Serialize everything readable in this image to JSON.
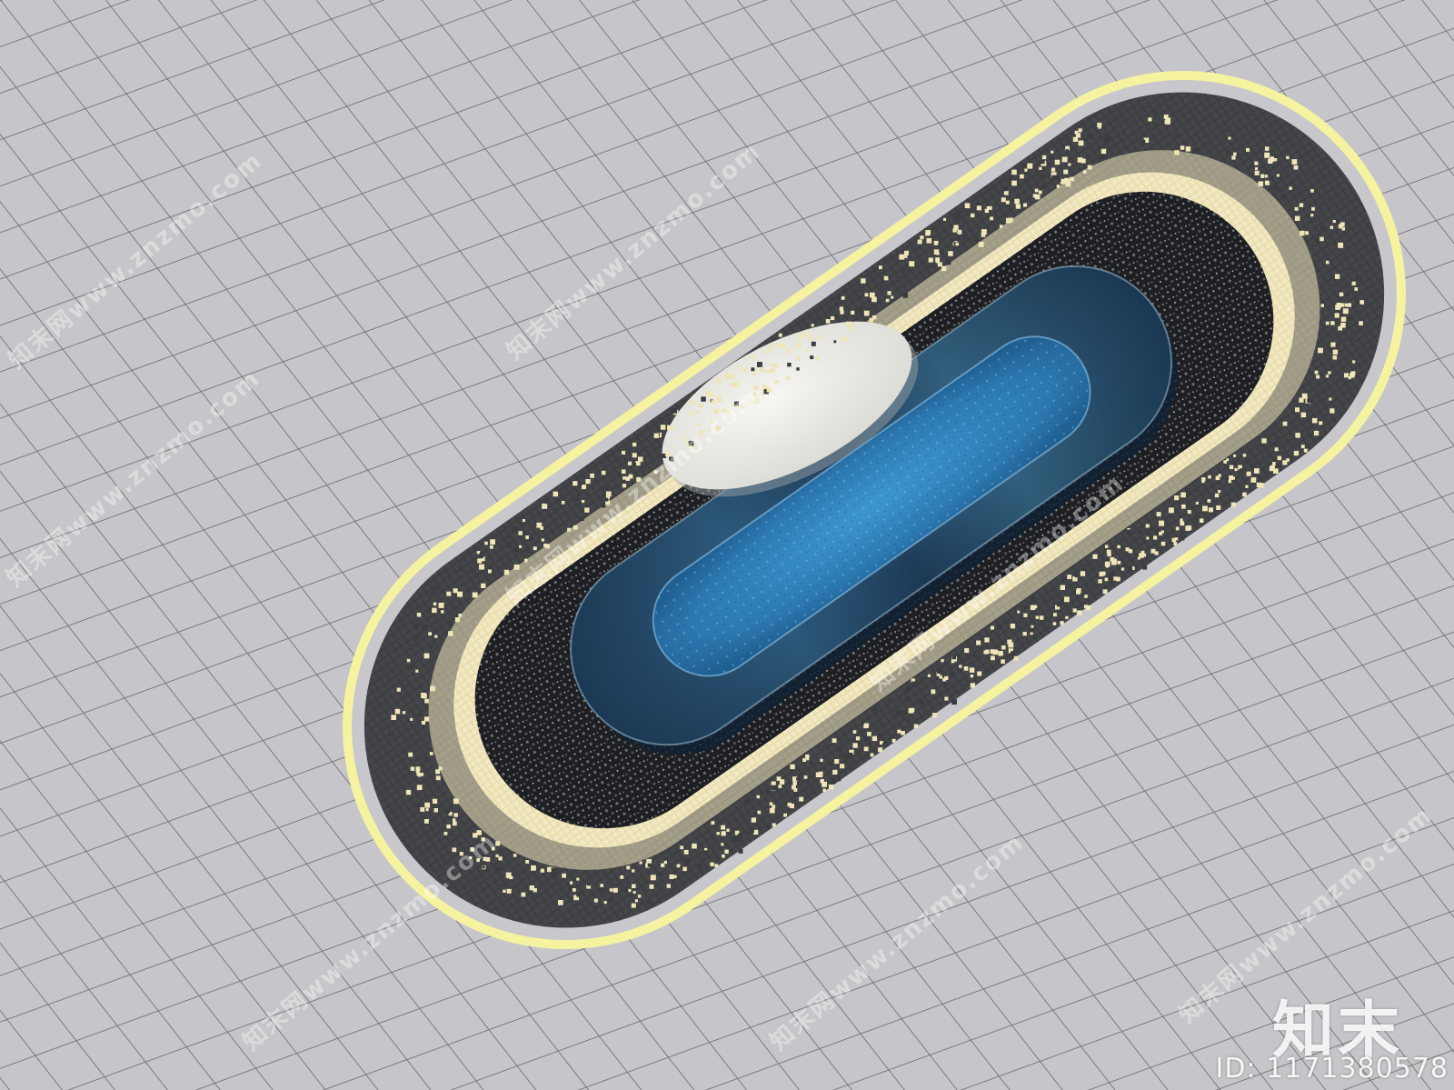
{
  "watermark": {
    "url_text": "知末网www.znzmo.com",
    "logo_text": "知末",
    "id_text": "ID: 1171380578"
  },
  "colors": {
    "floor": "#c4c4c8",
    "grid_line": "#78787c",
    "outer_glow": "#f4f19a",
    "dark_tile": "#3a3b3d",
    "cream_tile": "#efe5b8",
    "gravel": "#222326",
    "pool_rim": "#24476a",
    "water": "#2f7fb8",
    "stone": "#ebebe6"
  },
  "icons": {
    "pool": "oval-pool-render"
  }
}
